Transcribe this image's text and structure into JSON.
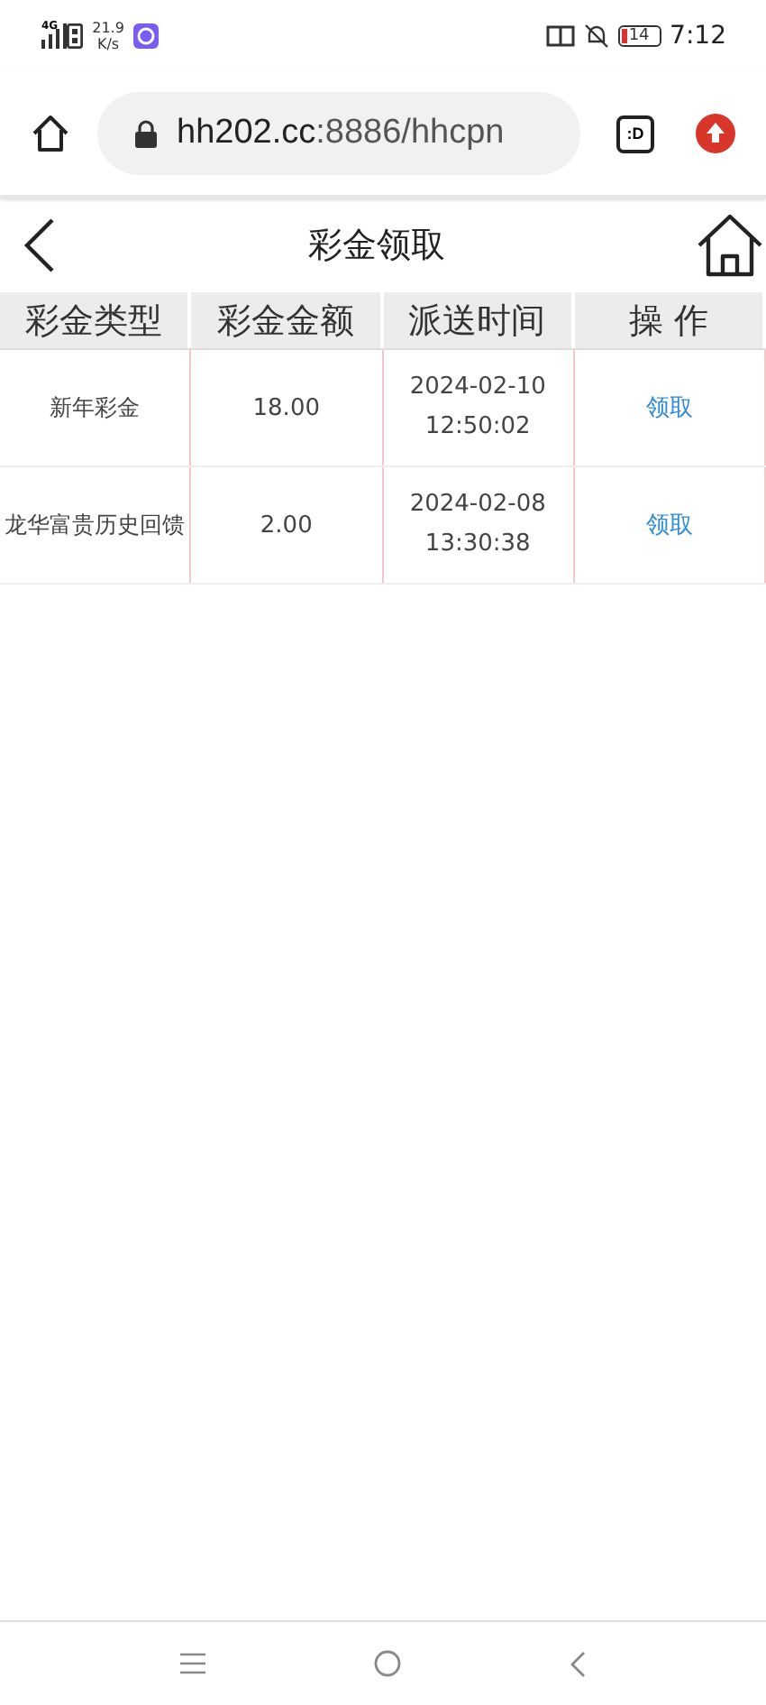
{
  "status_bar": {
    "network": "4G",
    "speed_value": "21.9",
    "speed_unit": "K/s",
    "battery": "14",
    "time": "7:12"
  },
  "browser": {
    "url_host": "hh202.cc",
    "url_rest": ":8886/hhcpn",
    "tab_button": ":D"
  },
  "header": {
    "title": "彩金领取"
  },
  "table": {
    "columns": [
      "彩金类型",
      "彩金金额",
      "派送时间",
      "操 作"
    ],
    "rows": [
      {
        "type": "新年彩金",
        "amount": "18.00",
        "date": "2024-02-10",
        "time": "12:50:02",
        "action": "领取"
      },
      {
        "type": "龙华富贵历史回馈",
        "amount": "2.00",
        "date": "2024-02-08",
        "time": "13:30:38",
        "action": "领取"
      }
    ]
  }
}
